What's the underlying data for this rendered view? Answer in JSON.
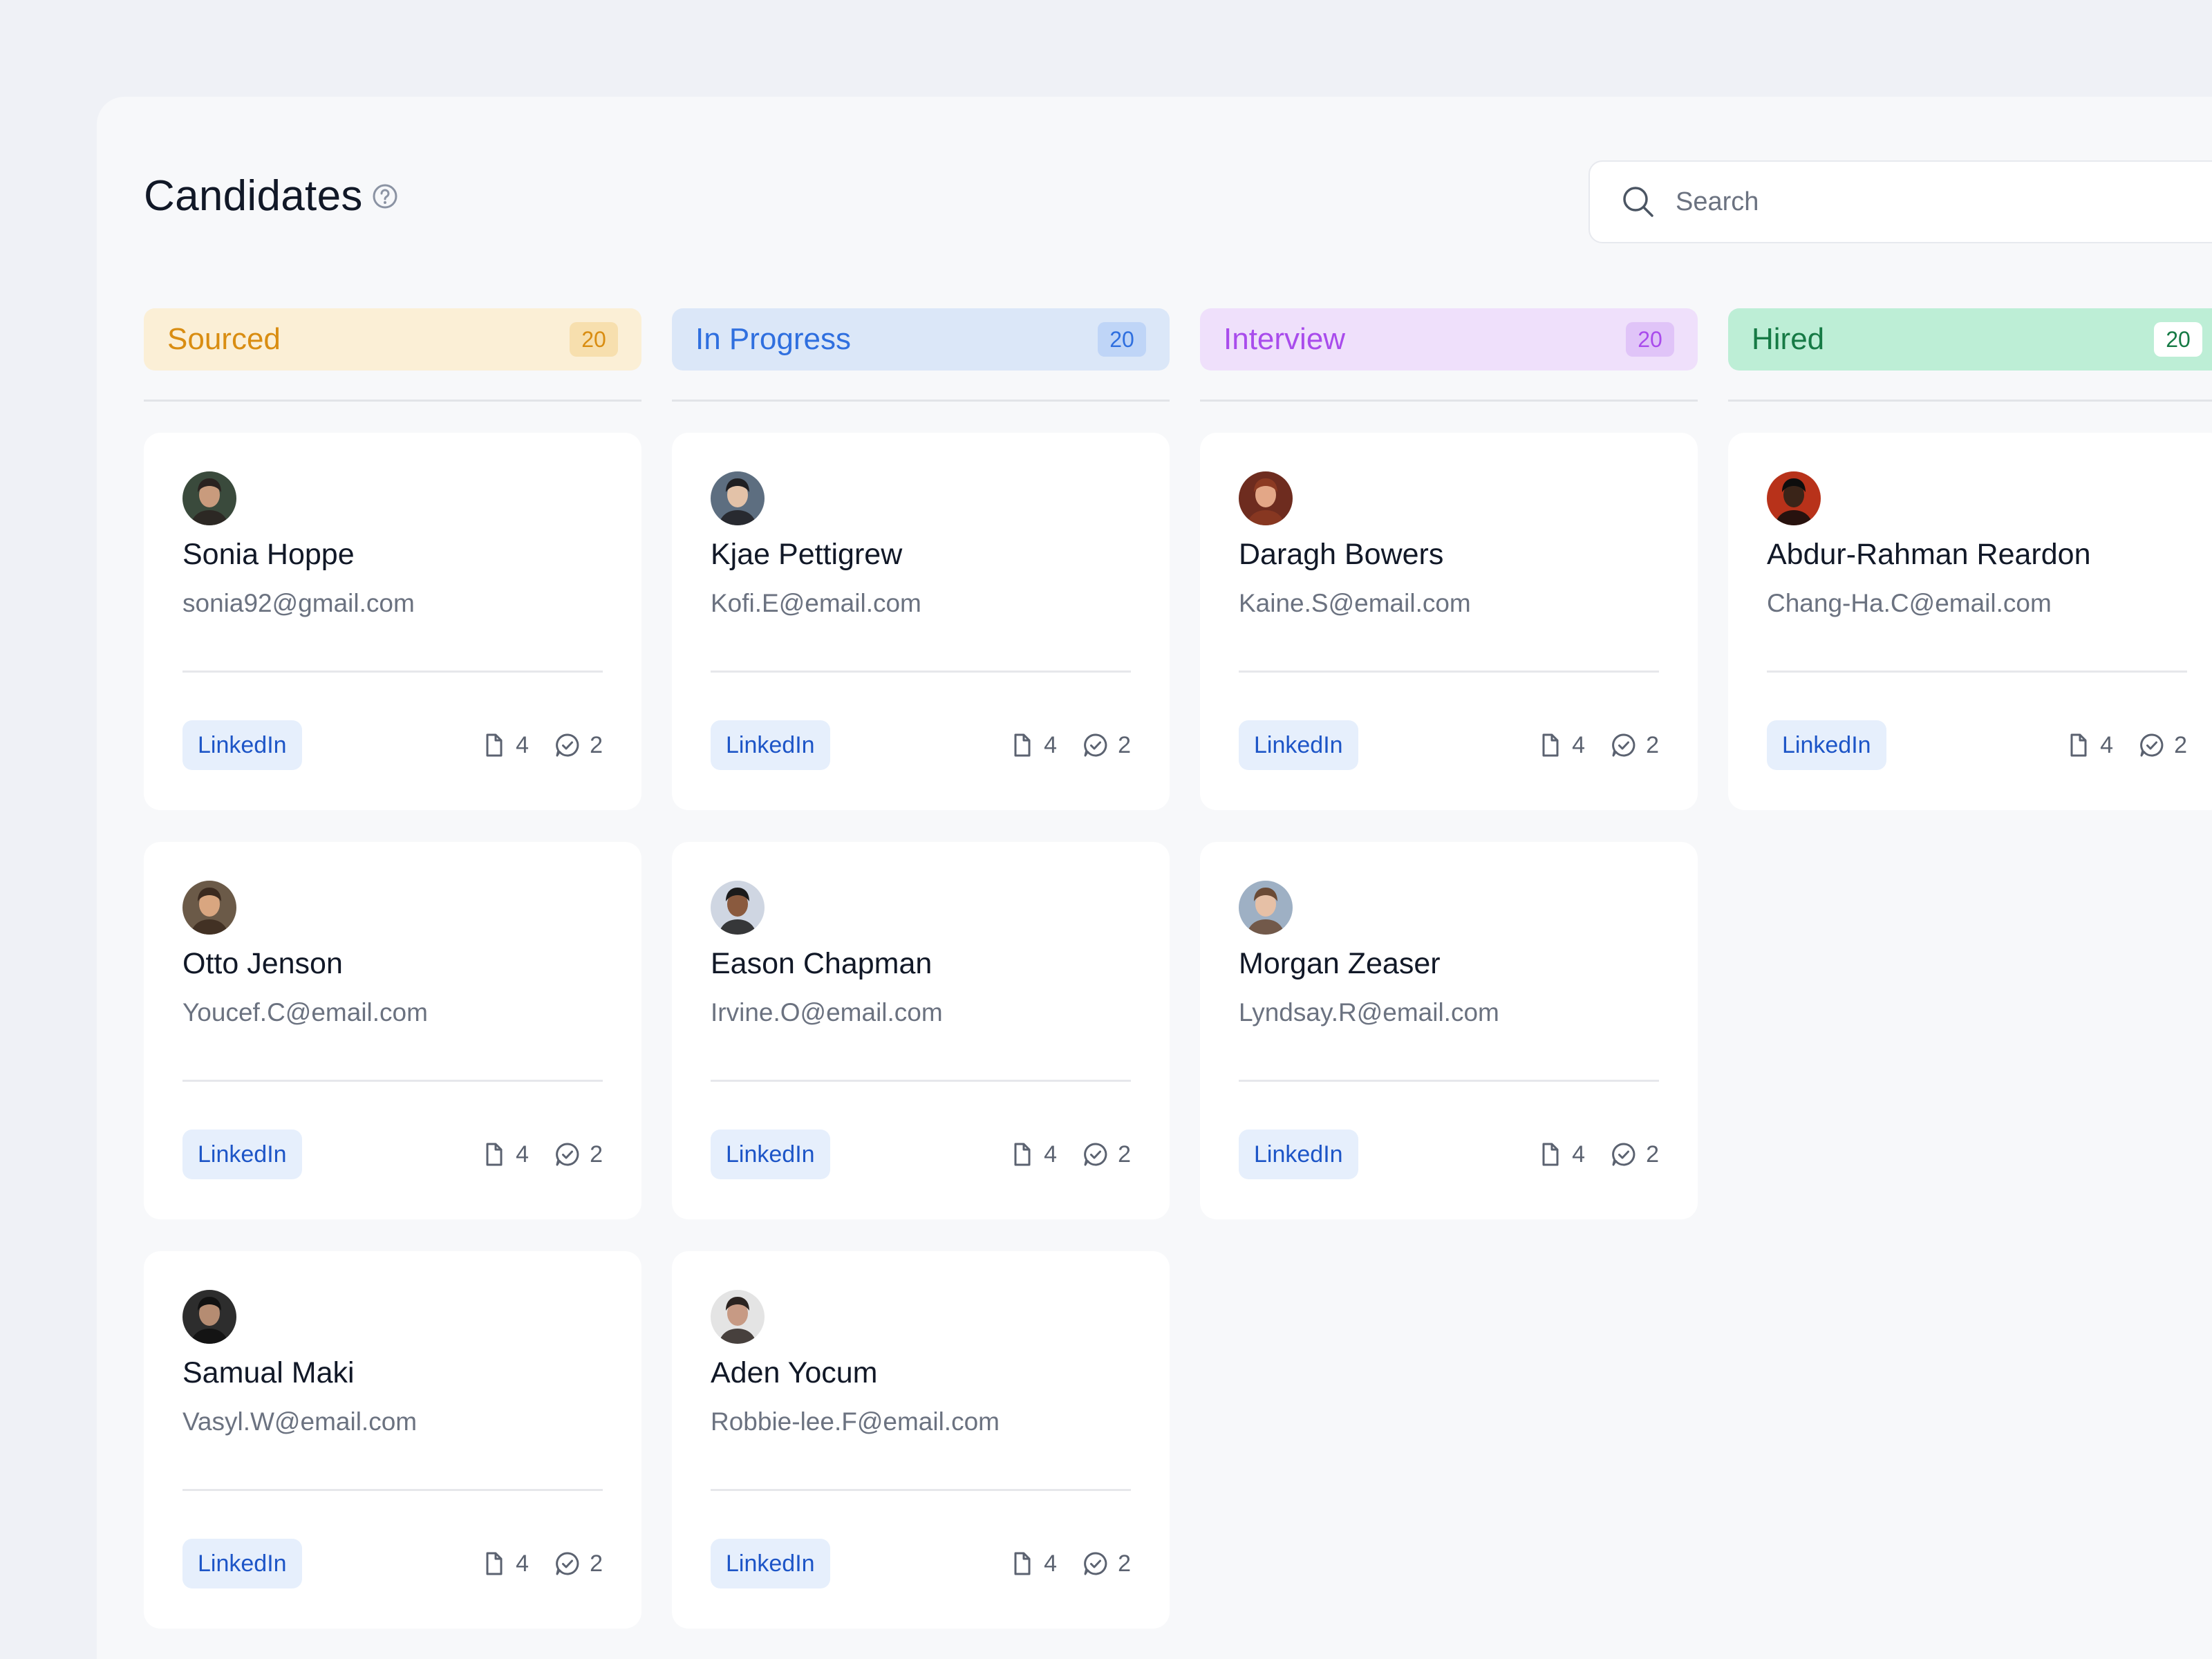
{
  "page": {
    "title": "Candidates",
    "search_placeholder": "Search"
  },
  "icons": {
    "help": "help-circle-icon",
    "search": "search-icon",
    "document": "document-icon",
    "comment": "chat-bubble-check-icon"
  },
  "colors": {
    "sourced_bg": "#fbefd6",
    "sourced_fg": "#d98d12",
    "sourced_badge": "#f7dfae",
    "progress_bg": "#dbe7f8",
    "progress_fg": "#2f6fdf",
    "progress_badge": "#bfd5f7",
    "interview_bg": "#efe0fb",
    "interview_fg": "#a94cec",
    "interview_badge": "#e0c4f8",
    "hired_bg": "#bdeed6",
    "hired_fg": "#167a45",
    "hired_badge": "#ffffff",
    "tag_bg": "#e6effc",
    "tag_fg": "#1d55c7"
  },
  "columns": [
    {
      "name": "Sourced",
      "count": "20",
      "cards": [
        {
          "name": "Sonia Hoppe",
          "email": "sonia92@gmail.com",
          "tag": "LinkedIn",
          "files": "4",
          "comments": "2"
        },
        {
          "name": "Otto Jenson",
          "email": "Youcef.C@email.com",
          "tag": "LinkedIn",
          "files": "4",
          "comments": "2"
        },
        {
          "name": "Samual Maki",
          "email": "Vasyl.W@email.com",
          "tag": "LinkedIn",
          "files": "4",
          "comments": "2"
        }
      ]
    },
    {
      "name": "In Progress",
      "count": "20",
      "cards": [
        {
          "name": "Kjae Pettigrew",
          "email": "Kofi.E@email.com",
          "tag": "LinkedIn",
          "files": "4",
          "comments": "2"
        },
        {
          "name": "Eason Chapman",
          "email": "Irvine.O@email.com",
          "tag": "LinkedIn",
          "files": "4",
          "comments": "2"
        },
        {
          "name": "Aden Yocum",
          "email": "Robbie-lee.F@email.com",
          "tag": "LinkedIn",
          "files": "4",
          "comments": "2"
        }
      ]
    },
    {
      "name": "Interview",
      "count": "20",
      "cards": [
        {
          "name": "Daragh Bowers",
          "email": "Kaine.S@email.com",
          "tag": "LinkedIn",
          "files": "4",
          "comments": "2"
        },
        {
          "name": "Morgan Zeaser",
          "email": "Lyndsay.R@email.com",
          "tag": "LinkedIn",
          "files": "4",
          "comments": "2"
        }
      ]
    },
    {
      "name": "Hired",
      "count": "20",
      "cards": [
        {
          "name": "Abdur-Rahman Reardon",
          "email": "Chang-Ha.C@email.com",
          "tag": "LinkedIn",
          "files": "4",
          "comments": "2"
        }
      ]
    }
  ]
}
